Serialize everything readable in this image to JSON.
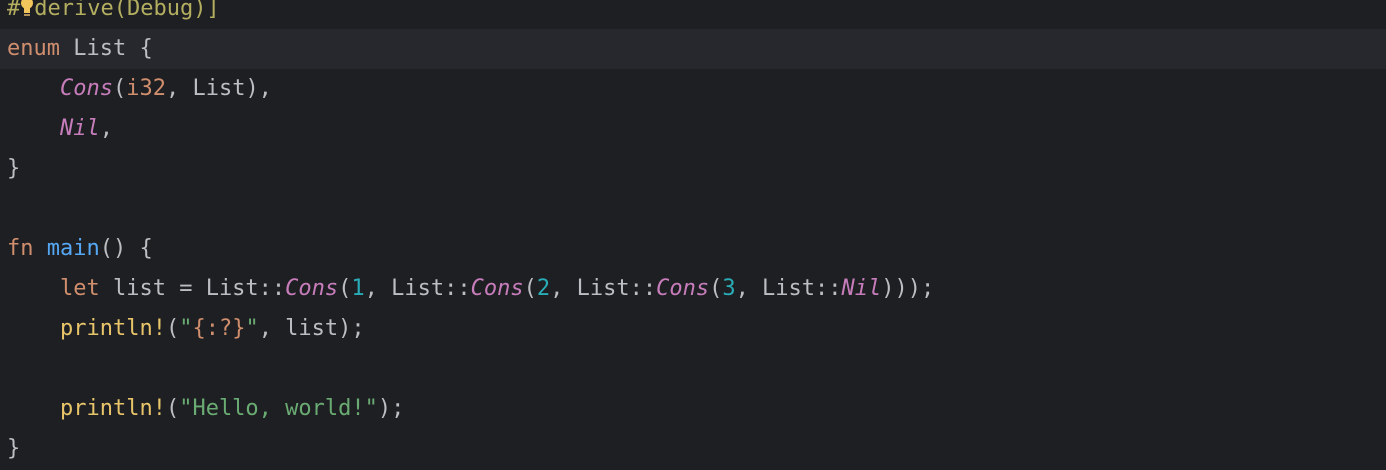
{
  "editor": {
    "language": "rust",
    "lines": [
      {
        "hash": "#",
        "attr_text": "derive(Debug)]"
      },
      {
        "kw": "enum",
        "name": " List",
        "rest": " {"
      },
      {
        "indent": "    ",
        "variant": "Cons",
        "open": "(",
        "type": "i32",
        "rest": ", List),"
      },
      {
        "indent": "    ",
        "variant": "Nil",
        "rest": ","
      },
      {
        "text": "}"
      },
      {
        "text": ""
      },
      {
        "kw": "fn",
        "space": " ",
        "fn": "main",
        "rest": "() {"
      },
      {
        "indent": "    ",
        "kw": "let",
        "t1": " list = List::",
        "v1": "Cons",
        "p1": "(",
        "n1": "1",
        "t2": ", List::",
        "v2": "Cons",
        "p2": "(",
        "n2": "2",
        "t3": ", List::",
        "v3": "Cons",
        "p3": "(",
        "n3": "3",
        "t4": ", List::",
        "v4": "Nil",
        "end": ")));"
      },
      {
        "indent": "    ",
        "macro": "println!",
        "p1": "(",
        "q1": "\"",
        "fmt": "{:?}",
        "q2": "\"",
        "rest": ", list);"
      },
      {
        "text": ""
      },
      {
        "indent": "    ",
        "macro": "println!",
        "p1": "(",
        "str": "\"Hello, world!\"",
        "rest": ");"
      },
      {
        "text": "}"
      }
    ],
    "icons": {
      "intention": "lightbulb-icon"
    },
    "colors": {
      "background": "#1e1f22",
      "current_line": "#26282e",
      "keyword": "#cf8e6d",
      "function": "#56a8f5",
      "enum_variant": "#c77dbb",
      "number": "#2aacb8",
      "string": "#6aab73",
      "macro": "#e8c46a",
      "attribute": "#b3ae60",
      "text": "#bcbec4"
    }
  }
}
